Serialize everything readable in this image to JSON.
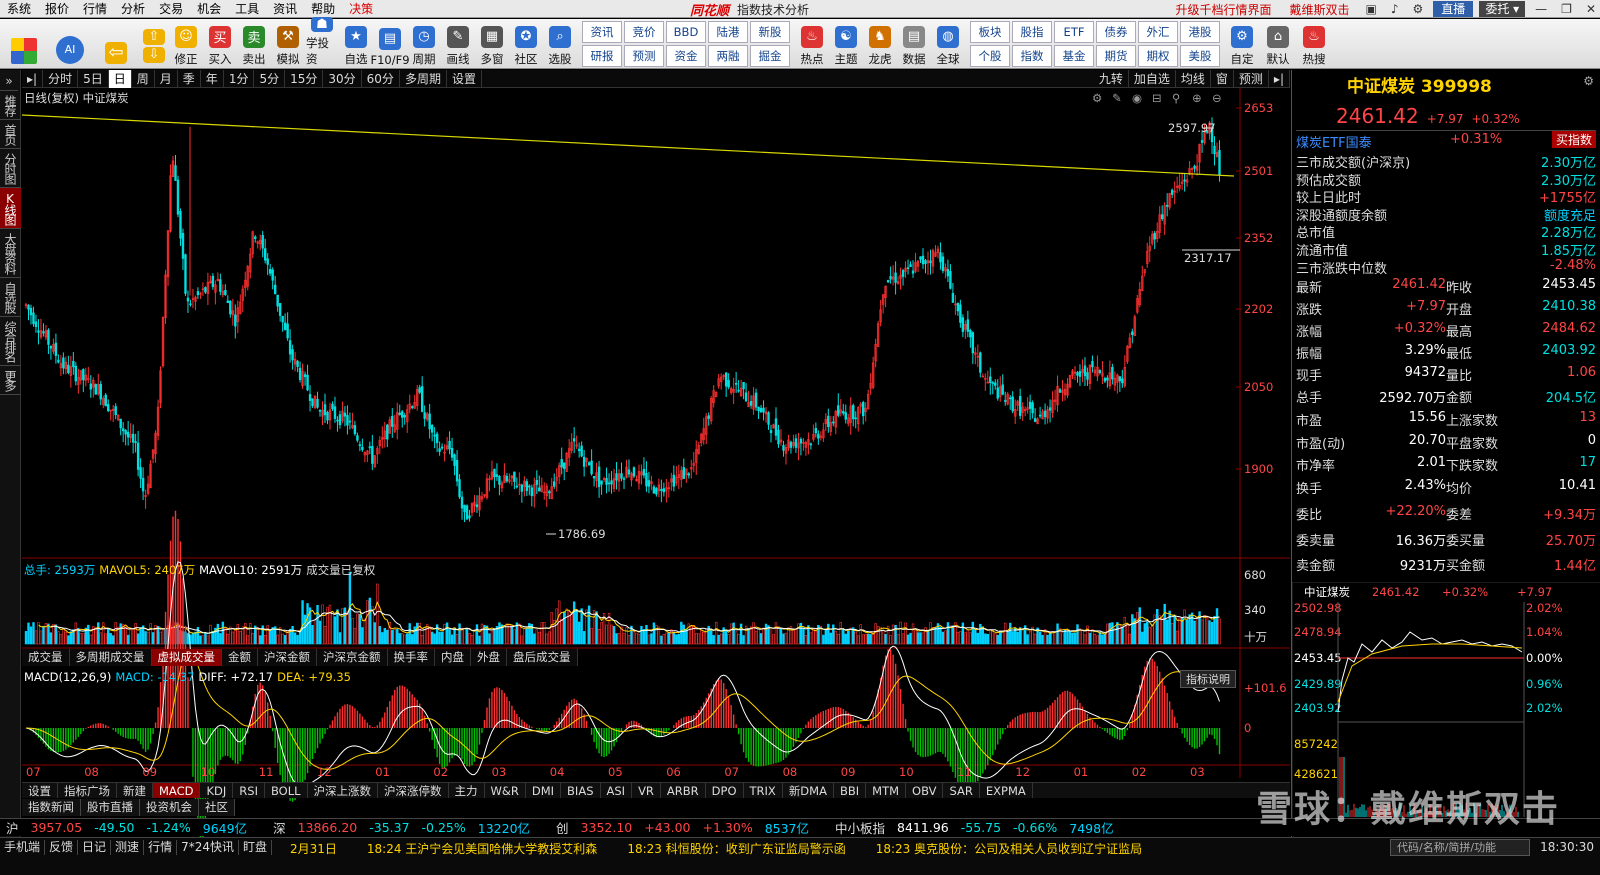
{
  "menu": [
    "系统",
    "报价",
    "行情",
    "分析",
    "交易",
    "机会",
    "工具",
    "资讯",
    "帮助",
    "决策"
  ],
  "app": {
    "logo": "同花顺",
    "subtitle": "指数技术分析"
  },
  "menuright": {
    "upgrade": "升级千档行情界面",
    "user": "戴维斯双击",
    "live": "直播",
    "trust": "委托"
  },
  "toolbar": [
    "修正",
    "买入",
    "卖出",
    "模拟",
    "学投资",
    "自选",
    "F10/F9",
    "周期",
    "画线",
    "多窗",
    "社区",
    "选股"
  ],
  "toolbar_grid": [
    "资讯",
    "竞价",
    "BBD",
    "陆港",
    "新股",
    "研报",
    "预测",
    "资金",
    "两融",
    "掘金"
  ],
  "toolbar2": [
    "热点",
    "主题",
    "龙虎",
    "数据",
    "全球"
  ],
  "toolbar_grid2": [
    "板块",
    "股指",
    "ETF",
    "债券",
    "外汇",
    "港股",
    "个股",
    "指数",
    "基金",
    "期货",
    "期权",
    "美股"
  ],
  "toolbar3": [
    "自定",
    "默认",
    "热搜"
  ],
  "lefttabs": [
    "推荐",
    "首页",
    "分时图",
    "K线图",
    "大盘资料",
    "自选股",
    "综合排名",
    "更多"
  ],
  "periods": [
    "分时",
    "5日",
    "日",
    "周",
    "月",
    "季",
    "年",
    "1分",
    "5分",
    "15分",
    "30分",
    "60分",
    "多周期",
    "设置"
  ],
  "periodright": [
    "九转",
    "加自选",
    "均线",
    "窗",
    "预测"
  ],
  "chart_head": "日线(复权) 中证煤炭",
  "price_axis": [
    "2653",
    "2501",
    "2352",
    "2202",
    "2050",
    "1900"
  ],
  "annot": {
    "high": "2597.97",
    "low": "1786.69",
    "mid": "2317.17"
  },
  "volhead": {
    "total": "总手: 2593万",
    "mavol5": "MAVOL5: 2407万",
    "mavol10": "MAVOL10: 2591万",
    "note": "成交量已复权"
  },
  "vol_axis": [
    "680",
    "340",
    "十万"
  ],
  "subtabs": [
    "成交量",
    "多周期成交量",
    "虚拟成交量",
    "金额",
    "沪深金额",
    "沪深京金额",
    "换手率",
    "内盘",
    "外盘",
    "盘后成交量"
  ],
  "macdhead": {
    "name": "MACD(12,26,9)",
    "macd": "MACD: -14.37",
    "diff": "DIFF: +72.17",
    "dea": "DEA: +79.35"
  },
  "macd_axis": [
    "+101.6",
    "0"
  ],
  "idx_explain": "指标说明",
  "months": [
    "07",
    "08",
    "09",
    "10",
    "11",
    "12",
    "01",
    "02",
    "03",
    "04",
    "05",
    "06",
    "07",
    "08",
    "09",
    "10",
    "11",
    "12",
    "01",
    "02",
    "03"
  ],
  "indtabs": [
    "设置",
    "指标广场",
    "新建",
    "MACD",
    "KDJ",
    "RSI",
    "BOLL",
    "沪深上涨数",
    "沪深涨停数",
    "主力",
    "W&R",
    "DMI",
    "BIAS",
    "ASI",
    "VR",
    "ARBR",
    "DPO",
    "TRIX",
    "新DMA",
    "BBI",
    "MTM",
    "OBV",
    "SAR",
    "EXPMA"
  ],
  "bottomtabs": [
    "指数新闻",
    "股市直播",
    "投资机会",
    "社区"
  ],
  "right": {
    "title": "中证煤炭 399998",
    "price": "2461.42",
    "chg": "+7.97",
    "pct": "+0.32%",
    "etf": {
      "name": "煤炭ETF国泰",
      "pct": "+0.31%",
      "btn": "买指数"
    },
    "info": [
      [
        "三市成交额(沪深京)",
        "2.30万亿"
      ],
      [
        "预估成交额",
        "2.30万亿"
      ],
      [
        "较上日此时",
        "+1755亿"
      ],
      [
        "深股通额度余额",
        "额度充足"
      ],
      [
        "总市值",
        "2.28万亿"
      ],
      [
        "流通市值",
        "1.85万亿"
      ],
      [
        "三市涨跌中位数",
        "-2.48%"
      ]
    ],
    "quote": [
      [
        "最新",
        "2461.42",
        "昨收",
        "2453.45"
      ],
      [
        "涨跌",
        "+7.97",
        "开盘",
        "2410.38"
      ],
      [
        "涨幅",
        "+0.32%",
        "最高",
        "2484.62"
      ],
      [
        "振幅",
        "3.29%",
        "最低",
        "2403.92"
      ],
      [
        "现手",
        "94372",
        "量比",
        "1.06"
      ],
      [
        "总手",
        "2592.70万",
        "金额",
        "204.5亿"
      ]
    ],
    "stats": [
      [
        "市盈",
        "15.56",
        "上涨家数",
        "13"
      ],
      [
        "市盈(动)",
        "20.70",
        "平盘家数",
        "0"
      ],
      [
        "市净率",
        "2.01",
        "下跌家数",
        "17"
      ],
      [
        "换手",
        "2.43%",
        "均价",
        "10.41"
      ]
    ],
    "order": [
      [
        "委比",
        "+22.20%",
        "委差",
        "+9.34万"
      ],
      [
        "委卖量",
        "16.36万",
        "委买量",
        "25.70万"
      ],
      [
        "卖金额",
        "9231万",
        "买金额",
        "1.44亿"
      ]
    ],
    "mini": {
      "name": "中证煤炭",
      "price": "2461.42",
      "pct": "+0.32%",
      "chg": "+7.97",
      "yaxis": [
        "2502.98",
        "2478.94",
        "2453.45",
        "2429.89",
        "2403.92"
      ],
      "paxis": [
        "2.02%",
        "1.04%",
        "0.00%",
        "0.96%",
        "2.02%"
      ],
      "vaxis": [
        "857242",
        "428621"
      ]
    }
  },
  "status": [
    [
      "沪",
      "3957.05",
      "-49.50",
      "-1.24%",
      "9649亿"
    ],
    [
      "深",
      "13866.20",
      "-35.37",
      "-0.25%",
      "13220亿"
    ],
    [
      "创",
      "3352.10",
      "+43.00",
      "+1.30%",
      "8537亿"
    ],
    [
      "中小板指",
      "8411.96",
      "-55.75",
      "-0.66%",
      "7498亿"
    ]
  ],
  "taskleft": [
    "手机端",
    "反馈",
    "日记",
    "测速",
    "行情",
    "7*24快讯",
    "盯盘"
  ],
  "news": [
    "2月31日",
    "18:24 王沪宁会见美国哈佛大学教授艾利森",
    "18:23 科恒股份：收到广东证监局警示函",
    "18:23 奥克股份：公司及相关人员收到辽宁证监局"
  ],
  "search": "代码/名称/简拼/功能",
  "clock": "18:30:30",
  "watermark": "雪球：戴维斯双击"
}
